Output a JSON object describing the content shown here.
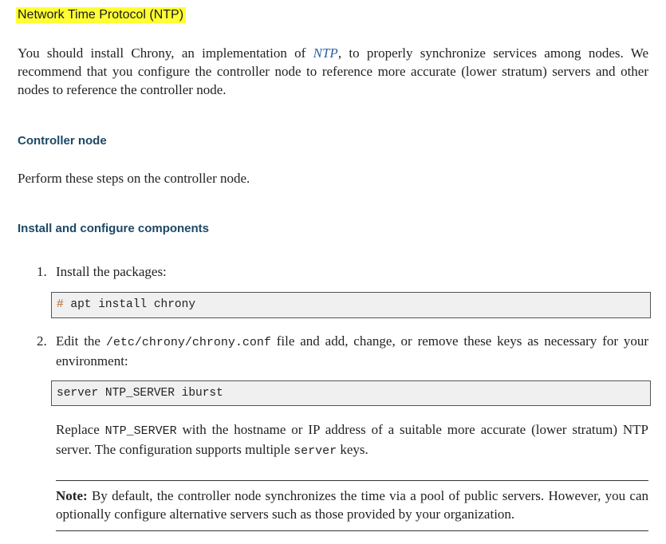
{
  "heading": {
    "title": "Network Time Protocol (NTP)"
  },
  "intro": {
    "text_before": "You should install Chrony, an implementation of ",
    "acronym": "NTP",
    "text_after": ", to properly synchronize services among nodes.  We recommend that you configure the controller node to reference more accurate (lower stratum) servers and other nodes to reference the controller node."
  },
  "controller_section": {
    "heading": "Controller node",
    "text": "Perform these steps on the controller node."
  },
  "install_section": {
    "heading": "Install and configure components",
    "steps": [
      {
        "number": "1.",
        "text": "Install the packages:",
        "code_prompt": "#",
        "code": " apt install chrony"
      },
      {
        "number": "2.",
        "text_before": "Edit the ",
        "path": "/etc/chrony/chrony.conf",
        "text_after": " file and add, change, or remove these keys as necessary for your environment:",
        "code": "server NTP_SERVER iburst"
      }
    ],
    "replace": {
      "text_before": "Replace ",
      "var": "NTP_SERVER",
      "text_middle": " with the hostname or IP address of a suitable more accurate (lower stratum) NTP server. The configuration supports multiple ",
      "key": "server",
      "text_after": " keys."
    },
    "note": {
      "label": "Note:",
      "text": "  By default, the controller node synchronizes the time via a pool of public servers. However, you can optionally configure alternative servers such as those provided by your organization."
    }
  }
}
